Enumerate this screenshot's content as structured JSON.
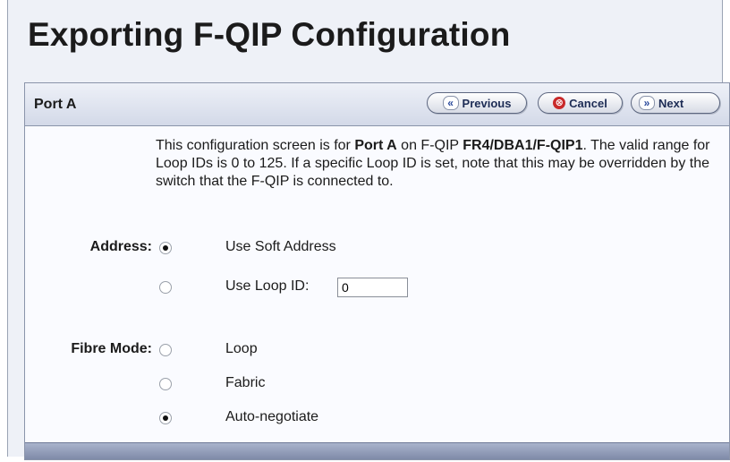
{
  "page_title": "Exporting F-QIP Configuration",
  "header": {
    "port_label": "Port A",
    "buttons": {
      "previous": "Previous",
      "cancel": "Cancel",
      "next": "Next"
    }
  },
  "description": {
    "part1": "This configuration screen is for ",
    "port": "Port A",
    "part2": " on F-QIP ",
    "device": "FR4/DBA1/F-QIP1",
    "part3": ". The valid range for Loop IDs is 0 to 125. If a specific Loop ID is set, note that this may be overridden by the switch that the F-QIP is connected to."
  },
  "address": {
    "label": "Address:",
    "options": [
      {
        "label": "Use Soft Address",
        "selected": true
      },
      {
        "label": "Use Loop ID:",
        "selected": false
      }
    ],
    "loop_id_value": "0"
  },
  "fibre_mode": {
    "label": "Fibre Mode:",
    "options": [
      {
        "label": "Loop",
        "selected": false
      },
      {
        "label": "Fabric",
        "selected": false
      },
      {
        "label": "Auto-negotiate",
        "selected": true
      }
    ]
  }
}
